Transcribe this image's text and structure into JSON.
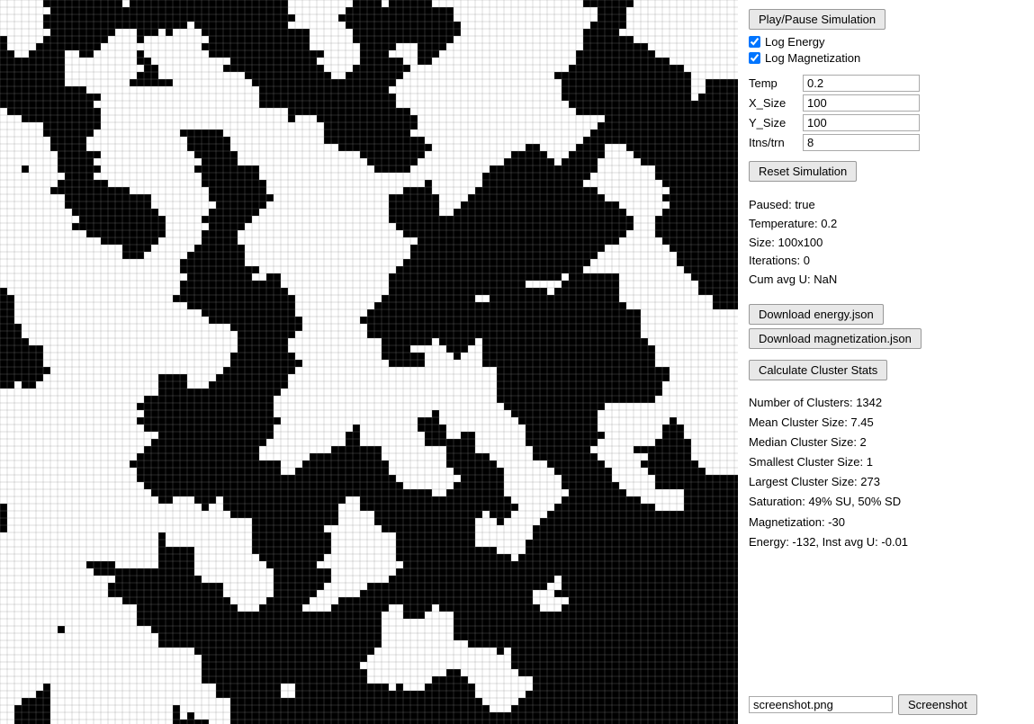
{
  "controls": {
    "play_pause_label": "Play/Pause Simulation",
    "log_energy_label": "Log Energy",
    "log_magnetization_label": "Log Magnetization",
    "log_energy_checked": true,
    "log_magnetization_checked": true,
    "temp_label": "Temp",
    "temp_value": "0.2",
    "xsize_label": "X_Size",
    "xsize_value": "100",
    "ysize_label": "Y_Size",
    "ysize_value": "100",
    "itns_label": "Itns/trn",
    "itns_value": "8",
    "reset_label": "Reset Simulation",
    "status": {
      "paused": "Paused: true",
      "temperature": "Temperature: 0.2",
      "size": "Size: 100x100",
      "iterations": "Iterations: 0",
      "cum_avg_u": "Cum avg U: NaN"
    },
    "download_energy_label": "Download energy.json",
    "download_magnetization_label": "Download magnetization.json",
    "calculate_cluster_label": "Calculate Cluster Stats",
    "cluster_stats": {
      "num_clusters": "Number of Clusters: 1342",
      "mean_size": "Mean Cluster Size: 7.45",
      "median_size": "Median Cluster Size: 2",
      "smallest_size": "Smallest Cluster Size: 1",
      "largest_size": "Largest Cluster Size: 273",
      "saturation": "Saturation: 49% SU, 50% SD",
      "magnetization": "Magnetization: -30",
      "energy": "Energy: -132, Inst avg U: -0.01"
    },
    "screenshot_filename": "screenshot.png",
    "screenshot_label": "Screenshot"
  }
}
